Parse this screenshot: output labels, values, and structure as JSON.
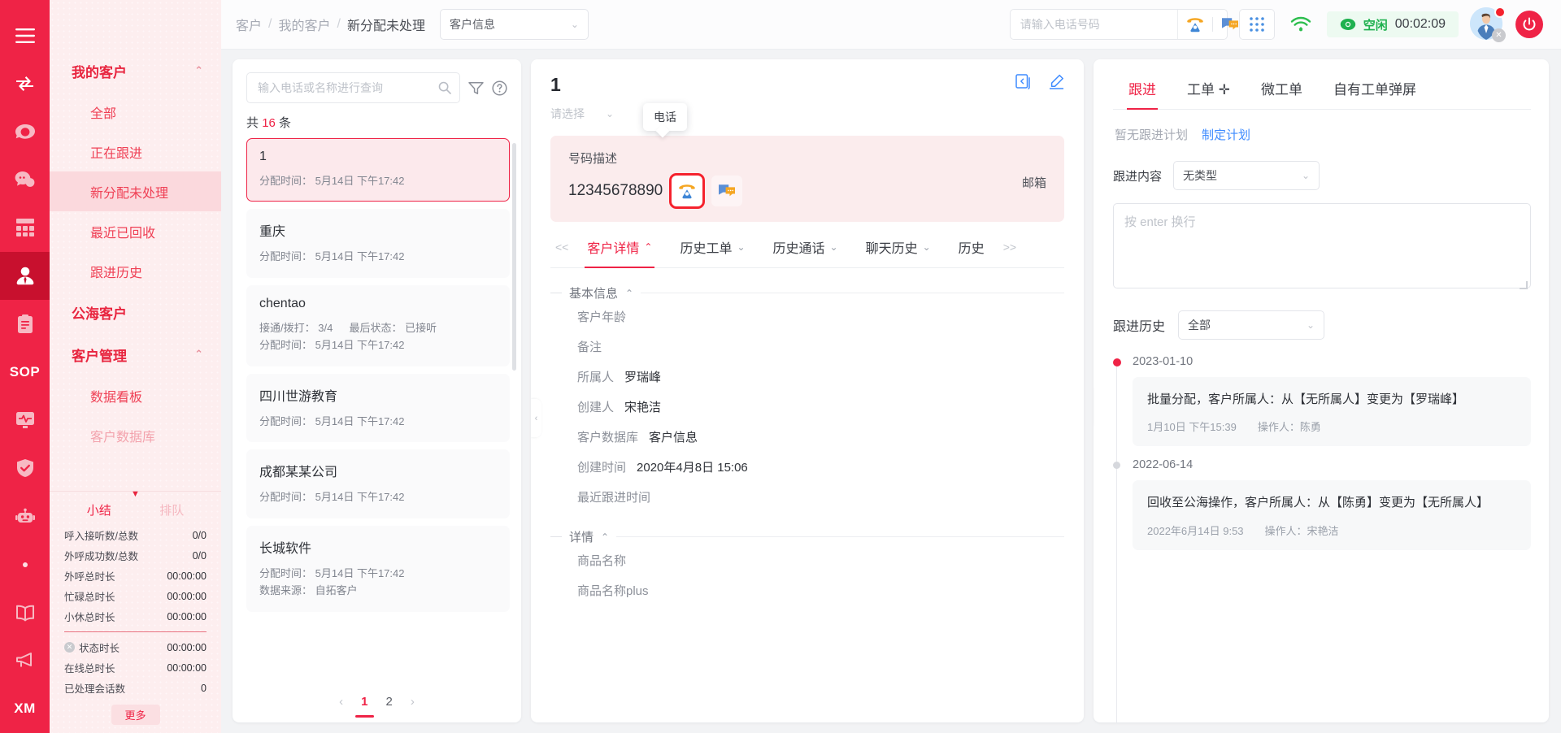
{
  "rail": {
    "items": [
      {
        "name": "menu-toggle-icon",
        "label": "菜单"
      },
      {
        "name": "transfer-icon",
        "label": "转接"
      },
      {
        "name": "phone-icon",
        "label": "电话"
      },
      {
        "name": "chat-icon",
        "label": "会话"
      },
      {
        "name": "grid-icon",
        "label": "应用"
      },
      {
        "name": "customer-icon",
        "label": "客户"
      },
      {
        "name": "clipboard-icon",
        "label": "工单"
      },
      {
        "name": "sop-icon",
        "label": "SOP"
      },
      {
        "name": "monitor-icon",
        "label": "监控"
      },
      {
        "name": "shield-icon",
        "label": "质检"
      },
      {
        "name": "robot-icon",
        "label": "机器人"
      },
      {
        "name": "dot-icon",
        "label": "更多"
      },
      {
        "name": "book-icon",
        "label": "知识库"
      },
      {
        "name": "megaphone-icon",
        "label": "通知"
      },
      {
        "name": "xm-icon",
        "label": "XM"
      }
    ],
    "activeIndex": 5
  },
  "sidebar": {
    "groups": [
      {
        "title": "我的客户",
        "items": [
          {
            "label": "全部",
            "active": false
          },
          {
            "label": "正在跟进",
            "active": false
          },
          {
            "label": "新分配未处理",
            "active": true
          },
          {
            "label": "最近已回收",
            "active": false
          },
          {
            "label": "跟进历史",
            "active": false
          }
        ]
      },
      {
        "title": "公海客户",
        "items": []
      },
      {
        "title": "客户管理",
        "items": [
          {
            "label": "数据看板",
            "active": false
          },
          {
            "label": "客户数据库",
            "active": false
          }
        ]
      }
    ]
  },
  "stats": {
    "tabs": [
      {
        "label": "小结",
        "active": true
      },
      {
        "label": "排队",
        "active": false
      }
    ],
    "rows_top": [
      {
        "label": "呼入接听数/总数",
        "value": "0/0"
      },
      {
        "label": "外呼成功数/总数",
        "value": "0/0"
      },
      {
        "label": "外呼总时长",
        "value": "00:00:00"
      },
      {
        "label": "忙碌总时长",
        "value": "00:00:00"
      },
      {
        "label": "小休总时长",
        "value": "00:00:00"
      }
    ],
    "rows_bottom": [
      {
        "label": "状态时长",
        "value": "00:00:00",
        "icon": "close-circle-icon"
      },
      {
        "label": "在线总时长",
        "value": "00:00:00",
        "icon": ""
      },
      {
        "label": "已处理会话数",
        "value": "0",
        "icon": ""
      }
    ],
    "more_label": "更多"
  },
  "topbar": {
    "breadcrumb": [
      "客户",
      "我的客户",
      "新分配未处理"
    ],
    "breadcrumb_sep": "/",
    "database_select": "客户信息",
    "phone_placeholder": "请输入电话号码",
    "phone_value": "",
    "status_label": "空闲",
    "status_time": "00:02:09"
  },
  "list": {
    "search_placeholder": "输入电话或名称进行查询",
    "search_value": "",
    "count_prefix": "共",
    "count_value": "16",
    "count_suffix": "条",
    "alloc_label": "分配时间：",
    "items": [
      {
        "title": "1",
        "alloc": "5月14日 下午17:42",
        "selected": true
      },
      {
        "title": "重庆",
        "alloc": "5月14日 下午17:42",
        "selected": false
      },
      {
        "title": "chentao",
        "alloc": "5月14日 下午17:42",
        "selected": false,
        "stats": "接通/拨打： 3/4",
        "stats2": "最后状态： 已接听"
      },
      {
        "title": "四川世游教育",
        "alloc": "5月14日 下午17:42",
        "selected": false
      },
      {
        "title": "成都某某公司",
        "alloc": "5月14日 下午17:42",
        "selected": false
      },
      {
        "title": "长城软件",
        "alloc": "5月14日 下午17:42",
        "selected": false,
        "source": "数据来源： 自拓客户"
      }
    ],
    "pager": {
      "prev": "‹",
      "next": "›",
      "pages": [
        "1",
        "2"
      ],
      "active": "1"
    }
  },
  "detail": {
    "title": "1",
    "select_placeholder": "请选择",
    "number_label": "号码描述",
    "number_value": "12345678890",
    "email_label": "邮箱",
    "tooltip": "电话",
    "tabs_prev": "<<",
    "tabs_next": ">>",
    "tabs": [
      {
        "label": "客户详情",
        "active": true,
        "chev": "⌃"
      },
      {
        "label": "历史工单",
        "active": false,
        "chev": "⌄"
      },
      {
        "label": "历史通话",
        "active": false,
        "chev": "⌄"
      },
      {
        "label": "聊天历史",
        "active": false,
        "chev": "⌄"
      },
      {
        "label": "历史",
        "active": false,
        "chev": ""
      }
    ],
    "basic_section": {
      "title": "基本信息",
      "fields": [
        {
          "k": "客户年龄",
          "v": ""
        },
        {
          "k": "备注",
          "v": ""
        },
        {
          "k": "所属人",
          "v": "罗瑞峰"
        },
        {
          "k": "创建人",
          "v": "宋艳洁"
        },
        {
          "k": "客户数据库",
          "v": "客户信息"
        },
        {
          "k": "创建时间",
          "v": "2020年4月8日 15:06"
        },
        {
          "k": "最近跟进时间",
          "v": ""
        }
      ]
    },
    "detail_section": {
      "title": "详情",
      "fields": [
        {
          "k": "商品名称",
          "v": ""
        },
        {
          "k": "商品名称plus",
          "v": ""
        }
      ]
    }
  },
  "follow": {
    "tabs": [
      {
        "label": "跟进",
        "active": true
      },
      {
        "label": "工单 ✛",
        "active": false
      },
      {
        "label": "微工单",
        "active": false
      },
      {
        "label": "自有工单弹屏",
        "active": false
      }
    ],
    "plan_none": "暂无跟进计划",
    "plan_link": "制定计划",
    "content_label": "跟进内容",
    "content_type": "无类型",
    "note_placeholder": "按 enter 换行",
    "note_value": "",
    "history_label": "跟进历史",
    "history_filter": "全部",
    "timeline": [
      {
        "date": "2023-01-10",
        "text": "批量分配，客户所属人：从【无所属人】变更为【罗瑞峰】",
        "time": "1月10日 下午15:39",
        "operator": "操作人：陈勇",
        "current": true
      },
      {
        "date": "2022-06-14",
        "text": "回收至公海操作，客户所属人：从【陈勇】变更为【无所属人】",
        "time": "2022年6月14日 9:53",
        "operator": "操作人：宋艳洁",
        "current": false
      }
    ]
  },
  "colors": {
    "brand": "#ef2346",
    "brand_dark": "#c8102e",
    "sidebar_bg": "#fdeeef",
    "status_green": "#1fb14f",
    "link_blue": "#3e8bff"
  }
}
